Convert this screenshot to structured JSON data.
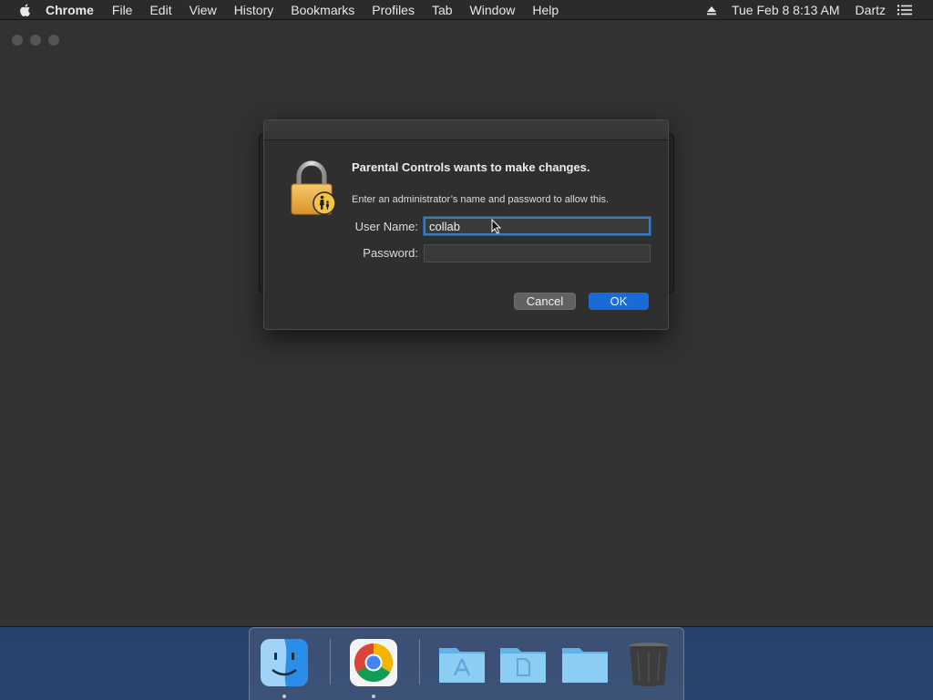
{
  "menubar": {
    "app_name": "Chrome",
    "items": [
      "File",
      "Edit",
      "View",
      "History",
      "Bookmarks",
      "Profiles",
      "Tab",
      "Window",
      "Help"
    ],
    "clock": "Tue Feb 8  8:13 AM",
    "user": "Dartz",
    "icons": [
      "apple-icon",
      "eject-icon",
      "list-icon"
    ]
  },
  "dialog": {
    "heading": "Parental Controls wants to make changes.",
    "message": "Enter an administrator’s name and password to allow this.",
    "username_label": "User Name:",
    "username_value": "collab",
    "password_label": "Password:",
    "password_value": "",
    "cancel_label": "Cancel",
    "ok_label": "OK",
    "icon": "parental-lock-icon"
  },
  "dock": {
    "items": [
      "finder-icon",
      "chrome-icon",
      "applications-folder-icon",
      "documents-folder-icon",
      "downloads-folder-icon",
      "trash-icon"
    ]
  },
  "colors": {
    "accent": "#1b6bd6",
    "focus_ring": "#3f79b8",
    "window_bg": "#323232",
    "menubar_bg": "#2b2b2b"
  }
}
